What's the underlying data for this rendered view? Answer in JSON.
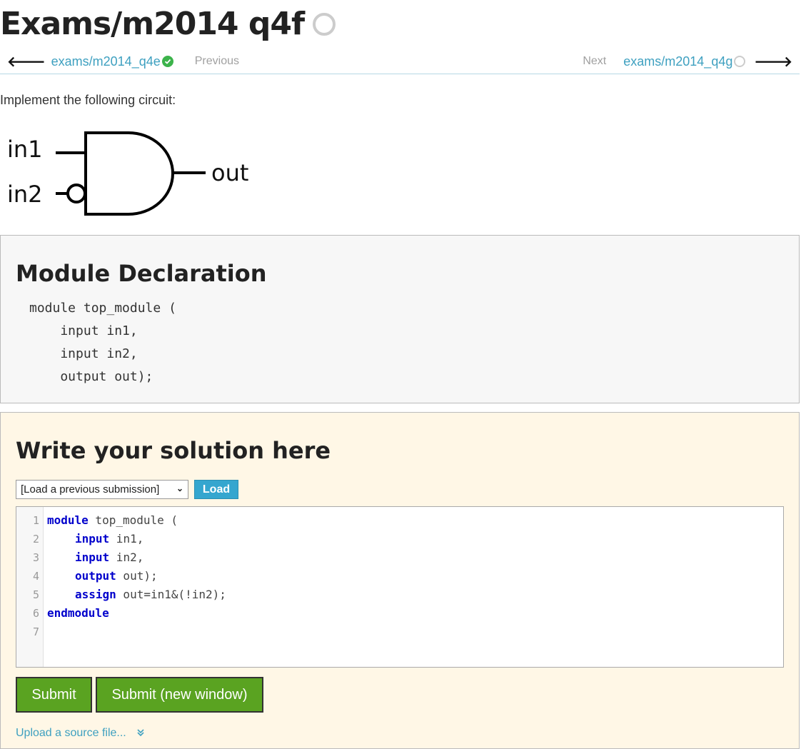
{
  "page": {
    "title": "Exams/m2014 q4f"
  },
  "nav": {
    "prev_link": "exams/m2014_q4e",
    "prev_label": "Previous",
    "next_label": "Next",
    "next_link": "exams/m2014_q4g"
  },
  "problem": {
    "intro": "Implement the following circuit:",
    "circuit": {
      "input1": "in1",
      "input2": "in2",
      "output": "out"
    }
  },
  "declaration": {
    "heading": "Module Declaration",
    "lines": [
      "module top_module (",
      "    input in1,",
      "    input in2,",
      "    output out);"
    ]
  },
  "solution": {
    "heading": "Write your solution here",
    "select_value": "[Load a previous submission]",
    "load_label": "Load",
    "code": {
      "line_numbers": [
        "1",
        "2",
        "3",
        "4",
        "5",
        "6",
        "7"
      ],
      "l1_kw": "module",
      "l1_rest": " top_module (",
      "l2_kw": "input",
      "l2_rest": " in1,",
      "l3_kw": "input",
      "l3_rest": " in2,",
      "l4_kw": "output",
      "l4_rest": " out);",
      "l5_kw": "assign",
      "l5_rest": " out=in1&(!in2);",
      "l6_kw": "endmodule"
    },
    "submit_label": "Submit",
    "submit_new_label": "Submit (new window)",
    "upload_label": "Upload a source file..."
  },
  "colors": {
    "link": "#3ea0c0",
    "success": "#3cb34b",
    "submit": "#5aa321",
    "load": "#35a6cf",
    "keyword": "#0000cc",
    "solution_bg": "#fff7e6"
  }
}
